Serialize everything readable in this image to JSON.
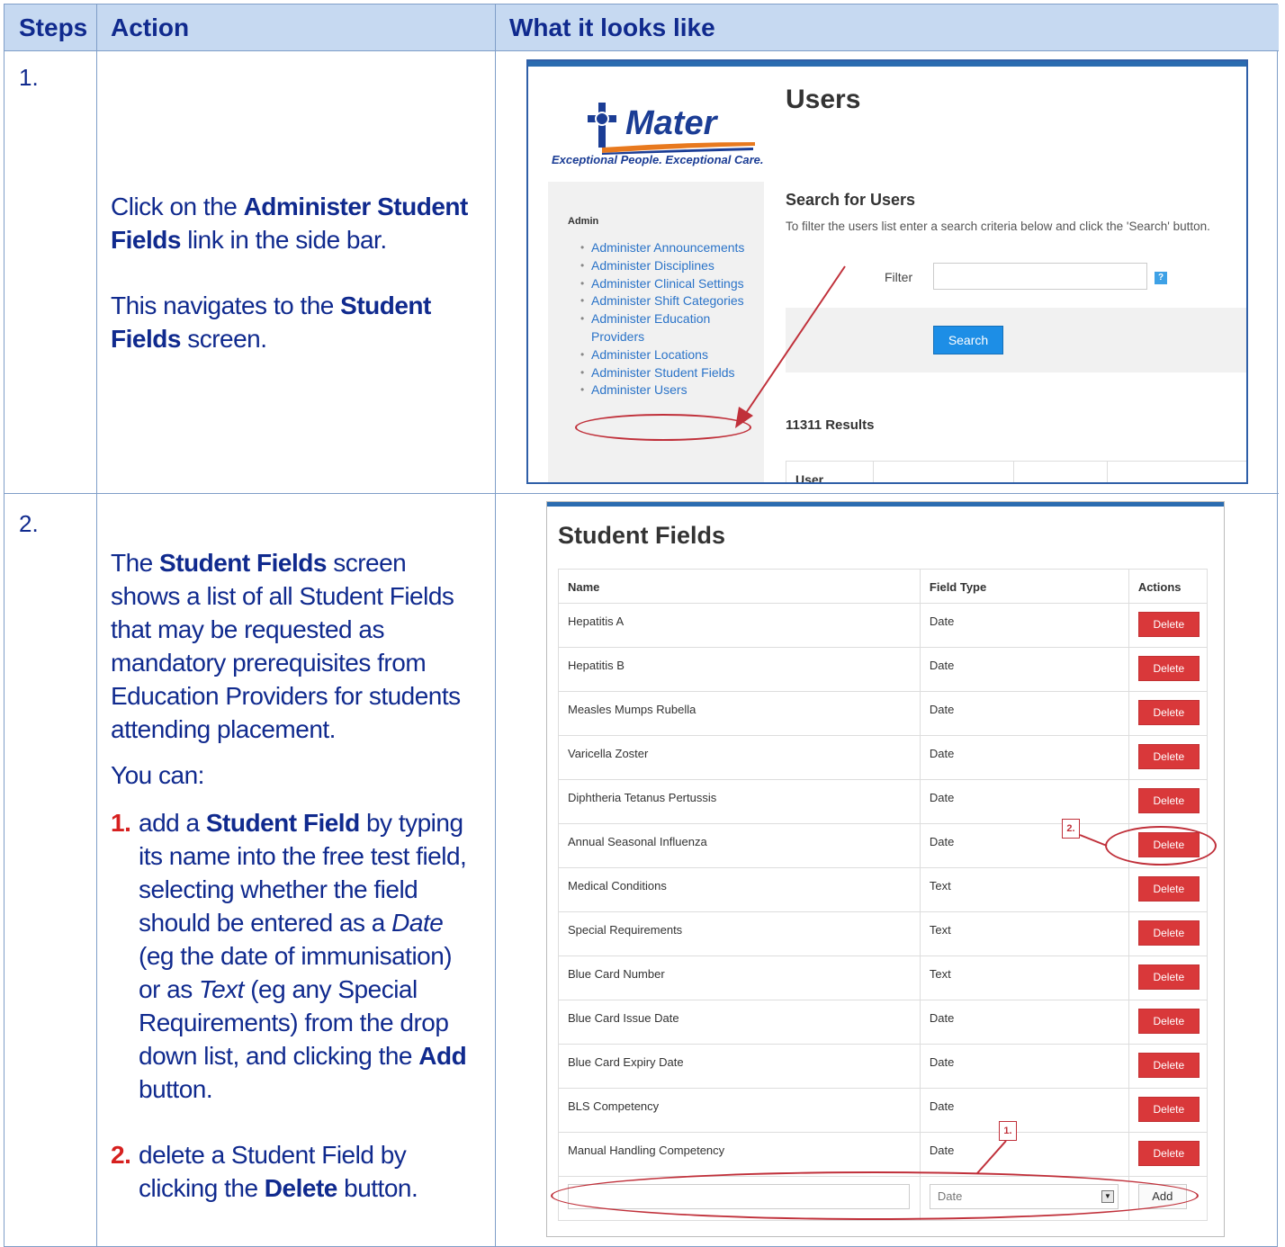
{
  "header": {
    "steps": "Steps",
    "action": "Action",
    "looks_like": "What it looks like"
  },
  "step1": {
    "number": "1.",
    "line1_a": "Click on the ",
    "line1_b": "Administer Student Fields",
    "line1_c": " link in the side bar.",
    "line2_a": "This navigates to the ",
    "line2_b": "Student Fields",
    "line2_c": " screen."
  },
  "step2": {
    "number": "2.",
    "intro_a": "The ",
    "intro_b": "Student Fields",
    "intro_c": " screen shows a list of all Student Fields that may be requested as mandatory prerequisites from Education Providers for students attending placement.",
    "you_can": "You can:",
    "item1_num": "1.",
    "item1_a": " add a ",
    "item1_b": "Student Field",
    "item1_c": " by typing its name into the free test field, selecting whether the field should be entered as a ",
    "item1_d": "Date",
    "item1_e": " (eg the date of immunisation) or as ",
    "item1_f": "Text",
    "item1_g": " (eg any Special Requirements) from the drop down list, and clicking the ",
    "item1_h": "Add",
    "item1_i": " button.",
    "item2_num": "2.",
    "item2_a": " delete a Student Field by clicking the ",
    "item2_b": "Delete",
    "item2_c": " button."
  },
  "users_screen": {
    "logo_word": "Mater",
    "logo_tagline": "Exceptional People. Exceptional Care.",
    "title": "Users",
    "sidebar_heading": "Admin",
    "sidebar_items": [
      "Administer Announcements",
      "Administer Disciplines",
      "Administer Clinical Settings",
      "Administer Shift Categories",
      "Administer Education Providers",
      "Administer Locations",
      "Administer Student Fields",
      "Administer Users"
    ],
    "search_title": "Search for Users",
    "search_desc": "To filter the users list enter a search criteria below and click the 'Search' button.",
    "filter_label": "Filter",
    "help": "?",
    "search_button": "Search",
    "results": "11311 Results",
    "table_first_header": "User"
  },
  "student_fields_screen": {
    "title": "Student Fields",
    "columns": [
      "Name",
      "Field Type",
      "Actions"
    ],
    "rows": [
      {
        "name": "Hepatitis A",
        "type": "Date"
      },
      {
        "name": "Hepatitis B",
        "type": "Date"
      },
      {
        "name": "Measles Mumps Rubella",
        "type": "Date"
      },
      {
        "name": "Varicella Zoster",
        "type": "Date"
      },
      {
        "name": "Diphtheria Tetanus Pertussis",
        "type": "Date"
      },
      {
        "name": "Annual Seasonal Influenza",
        "type": "Date"
      },
      {
        "name": "Medical Conditions",
        "type": "Text"
      },
      {
        "name": "Special Requirements",
        "type": "Text"
      },
      {
        "name": "Blue Card Number",
        "type": "Text"
      },
      {
        "name": "Blue Card Issue Date",
        "type": "Date"
      },
      {
        "name": "Blue Card Expiry Date",
        "type": "Date"
      },
      {
        "name": "BLS Competency",
        "type": "Date"
      },
      {
        "name": "Manual Handling Competency",
        "type": "Date"
      }
    ],
    "delete_label": "Delete",
    "select_value": "Date",
    "add_label": "Add",
    "annotation_1": "1.",
    "annotation_2": "2."
  },
  "colors": {
    "header_bg": "#c6d9f1",
    "text_navy": "#102a8e",
    "accent_red": "#d6201f",
    "delete_red": "#d9383a",
    "link_blue": "#2a73c8"
  }
}
